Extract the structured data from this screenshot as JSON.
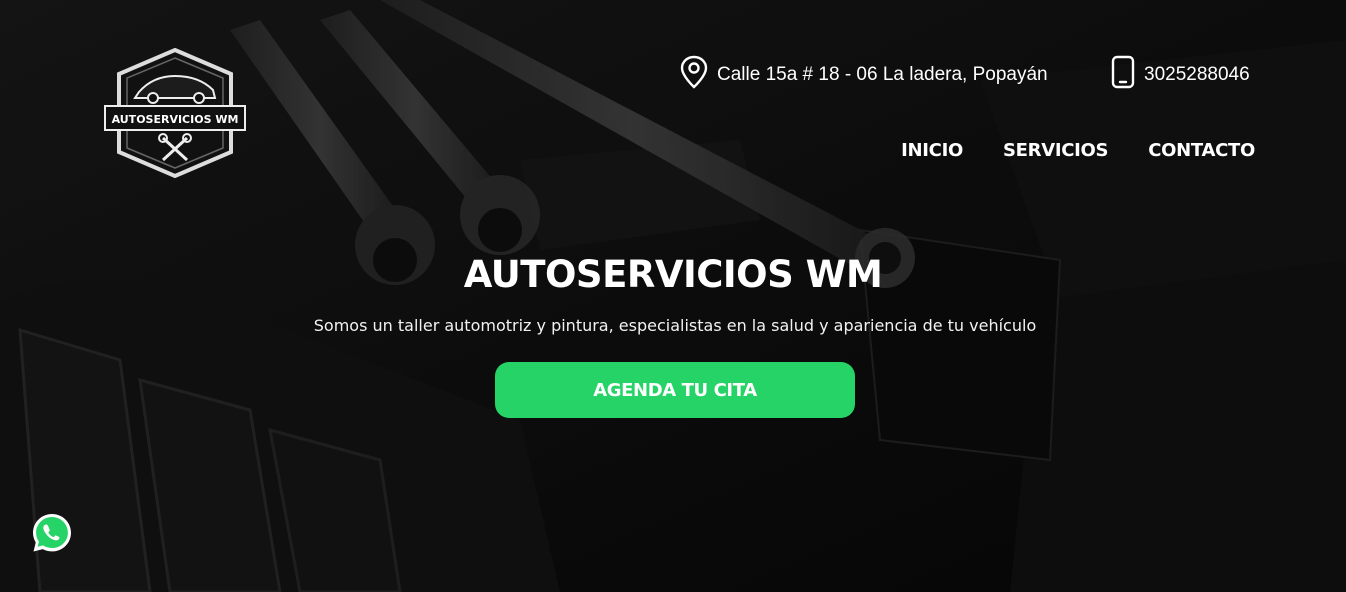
{
  "brand": {
    "logo_text": "AUTOSERVICIOS WM"
  },
  "header": {
    "address": "Calle 15a # 18 - 06 La ladera, Popayán",
    "phone": "3025288046"
  },
  "nav": {
    "items": [
      {
        "label": "INICIO"
      },
      {
        "label": "SERVICIOS"
      },
      {
        "label": "CONTACTO"
      }
    ]
  },
  "hero": {
    "title": "AUTOSERVICIOS WM",
    "subtitle": "Somos un taller automotriz y pintura, especialistas en la salud y apariencia de tu vehículo",
    "cta_label": "AGENDA TU CITA"
  },
  "colors": {
    "cta": "#25d366",
    "background": "#0d0d0d",
    "text": "#ffffff"
  },
  "icons": {
    "address": "map-pin-icon",
    "phone": "smartphone-icon",
    "floating": "whatsapp-icon"
  }
}
